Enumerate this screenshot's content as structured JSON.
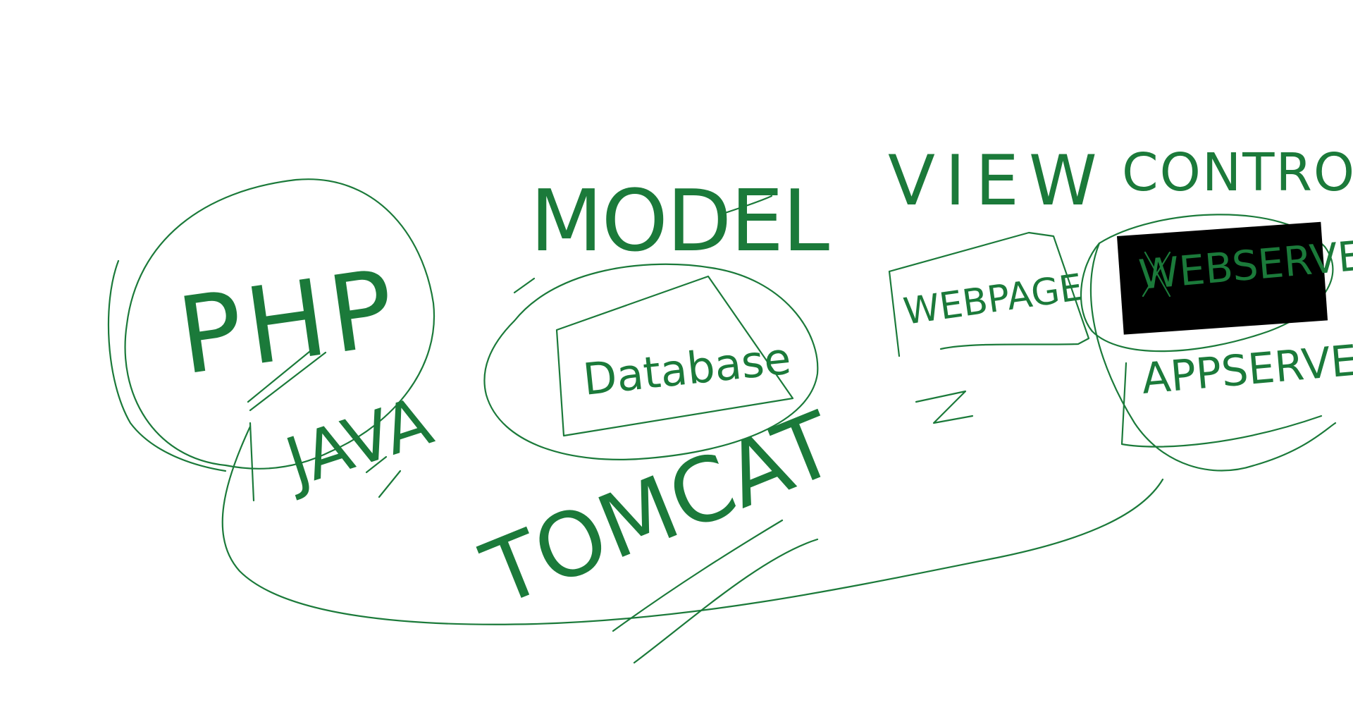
{
  "ink_color": "#1b7a3a",
  "background_color": "#ffffff",
  "labels": {
    "php": "PHP",
    "java": "JAVA",
    "model": "MODEL",
    "database": "Database",
    "view": "VIEW",
    "controller": "CONTROLLER",
    "webpage": "WEBPAGE",
    "webserver": "WEBSERVER",
    "appserver": "APPSERVER",
    "tomcat": "TOMCAT"
  }
}
